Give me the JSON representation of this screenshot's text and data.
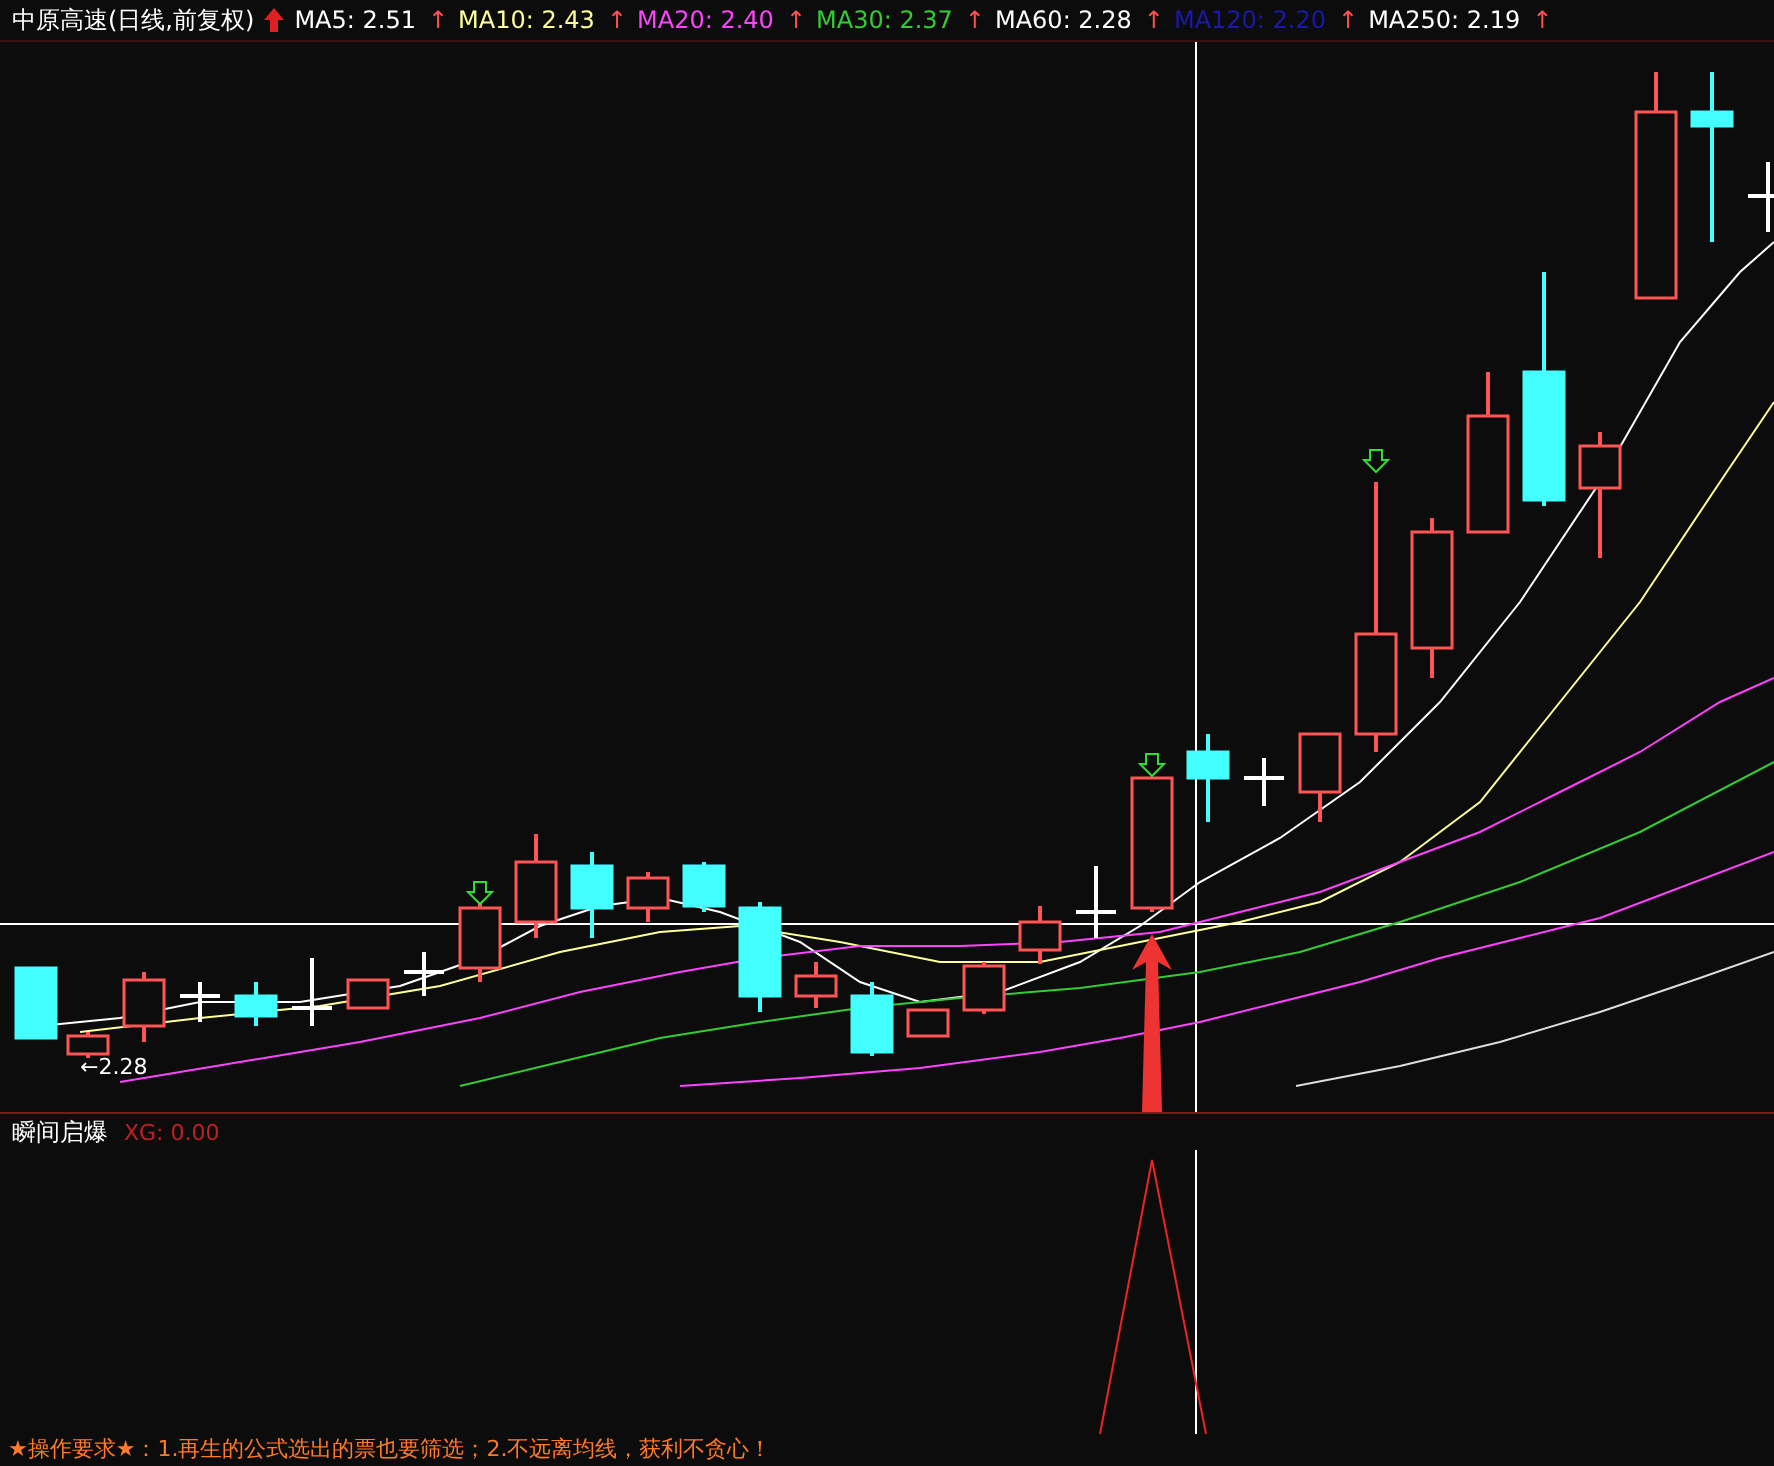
{
  "header": {
    "title": "中原高速(日线,前复权)",
    "indicators": [
      {
        "label": "MA5: 2.51",
        "color": "#ffffff",
        "marker": "↑"
      },
      {
        "label": "MA10: 2.43",
        "color": "#ffff99",
        "marker": "↑"
      },
      {
        "label": "MA20: 2.40",
        "color": "#ff44ff",
        "marker": "↑"
      },
      {
        "label": "MA30: 2.37",
        "color": "#33cc33",
        "marker": "↑"
      },
      {
        "label": "MA60: 2.28",
        "color": "#ffffff",
        "marker": "↑"
      },
      {
        "label": "MA120: 2.20",
        "color": "#1a1aaa",
        "marker": "↑"
      },
      {
        "label": "MA250: 2.19",
        "color": "#ffffff",
        "marker": "↑"
      }
    ]
  },
  "price_label": "←2.28",
  "indicator_panel": {
    "title": "瞬间启爆",
    "reading": "XG: 0.00"
  },
  "note": "★操作要求★：1.再生的公式选出的票也要筛选；2.不远离均线，获利不贪心！"
}
